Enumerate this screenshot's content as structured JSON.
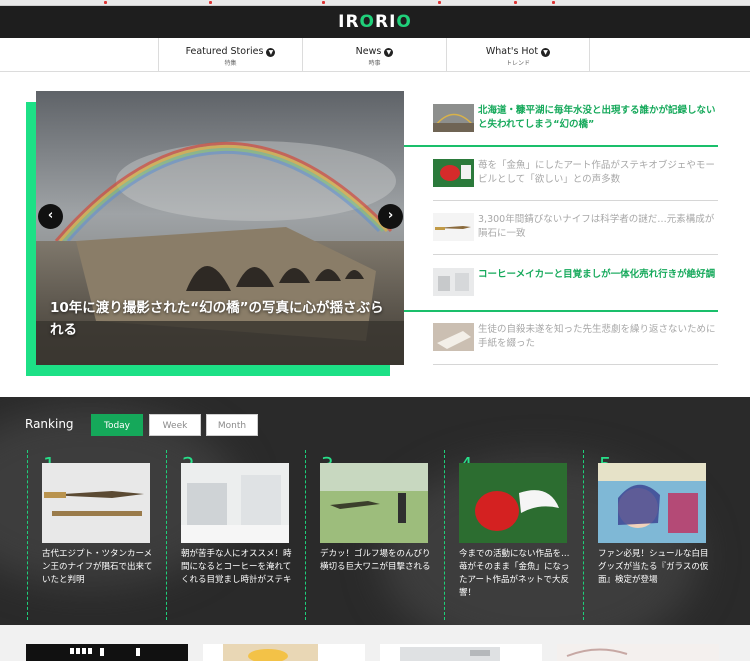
{
  "site": {
    "logo": "IRORIO"
  },
  "nav": [
    {
      "en": "Featured Stories",
      "jp": "特集"
    },
    {
      "en": "News",
      "jp": "時事"
    },
    {
      "en": "What's Hot",
      "jp": "トレンド"
    }
  ],
  "hero": {
    "title": "10年に渡り撮影された“幻の橋”の写真に心が揺さぶられる"
  },
  "side_list": [
    {
      "title": "北海道・糠平湖に毎年水没と出現する誰かが記録しないと失われてしまう“幻の橋”",
      "state": "hot"
    },
    {
      "title": "苺を「金魚」にしたアート作品がステキオブジェやモービルとして「欲しい」との声多数",
      "state": "dim"
    },
    {
      "title": "3,300年間錆びないナイフは科学者の謎だ…元素構成が隕石に一致",
      "state": "dim"
    },
    {
      "title": "コーヒーメイカーと目覚ましが一体化売れ行きが絶好調",
      "state": "hot"
    },
    {
      "title": "生徒の自殺未遂を知った先生悲劇を繰り返さないために手紙を綴った",
      "state": "dim"
    }
  ],
  "ranking": {
    "title": "Ranking",
    "tabs": [
      "Today",
      "Week",
      "Month"
    ],
    "active_tab": "Today",
    "items": [
      {
        "rank": "1",
        "title": "古代エジプト・ツタンカーメン王のナイフが隕石で出来ていたと判明"
      },
      {
        "rank": "2",
        "title": "朝が苦手な人にオススメ！時間になるとコーヒーを淹れてくれる目覚まし時計がステキ"
      },
      {
        "rank": "3",
        "title": "デカッ！ゴルフ場をのんびり横切る巨大ワニが目撃される"
      },
      {
        "rank": "4",
        "title": "今までの活動にない作品を…苺がそのまま「金魚」になったアート作品がネットで大反響！"
      },
      {
        "rank": "5",
        "title": "ファン必見！シュールな白目グッズが当たる『ガラスの仮面』検定が登場"
      }
    ]
  },
  "colors": {
    "accent": "#1de086",
    "accent_dark": "#15a85a",
    "hot_text": "#16a95b",
    "ranking_bg": "#2a2a2a"
  }
}
